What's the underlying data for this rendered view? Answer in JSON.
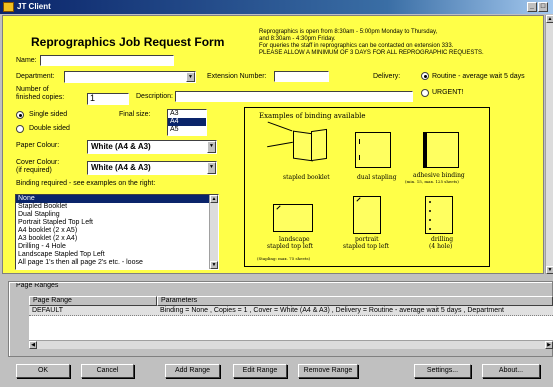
{
  "window": {
    "title": "JT Client",
    "min": "_",
    "max": "□"
  },
  "form": {
    "heading": "Reprographics Job Request Form",
    "info": [
      "Reprographics is open from 8:30am - 5:00pm Monday to Thursday,",
      "and 8:30am - 4:30pm Friday.",
      "For queries the staff in reprographics can be contacted on extension 333.",
      "PLEASE ALLOW A MINIMUM OF 3 DAYS FOR ALL REPROGRAPHIC REQUESTS."
    ],
    "name_label": "Name:",
    "name_value": "",
    "department_label": "Department:",
    "extension_label": "Extension Number:",
    "delivery_label": "Delivery:",
    "delivery_routine": "Routine - average wait 5 days",
    "delivery_urgent": "URGENT!",
    "copies_label_1": "Number of",
    "copies_label_2": "finished copies:",
    "copies_value": "1",
    "description_label": "Description:",
    "single_sided": "Single sided",
    "double_sided": "Double sided",
    "final_size_label": "Final size:",
    "sizes": [
      "A3",
      "A4",
      "A5"
    ],
    "selected_size": "A4",
    "paper_colour_label": "Paper Colour:",
    "paper_colour_value": "White (A4 & A3)",
    "cover_colour_label_1": "Cover Colour:",
    "cover_colour_label_2": "(if required)",
    "cover_colour_value": "White (A4 & A3)",
    "binding_required_label": "Binding required - see examples on the right:",
    "binding_options": [
      "None",
      "Stapled Booklet",
      "Dual Stapling",
      "Portrait Stapled Top Left",
      "A4 booklet (2 x A5)",
      "A3 booklet (2 x A4)",
      "Drilling - 4 Hole",
      "Landscape Stapled Top Left",
      "All page 1's then all page 2's etc. - loose"
    ],
    "binding_selected": "None",
    "binding_panel": {
      "title": "Examples of binding available",
      "labels": {
        "stapled_booklet": "stapled booklet",
        "dual_stapling": "dual stapling",
        "adhesive_1": "adhesive binding",
        "adhesive_2": "(min. 15, max. 125 sheets)",
        "landscape_1": "landscape",
        "landscape_2": "stapled top left",
        "portrait_1": "portrait",
        "portrait_2": "stapled top left",
        "drilling_1": "drilling",
        "drilling_2": "(4 hole)",
        "stapling_note": "(Stapling: max. 75 sheets)"
      }
    }
  },
  "ranges": {
    "title": "Page Ranges",
    "col_range": "Page Range",
    "col_params": "Parameters",
    "rows": [
      {
        "range": "DEFAULT",
        "params": "Binding = None , Copies = 1 , Cover = White (A4 & A3) , Delivery = Routine - average wait 5 days , Department"
      }
    ]
  },
  "buttons": {
    "ok": "OK",
    "cancel": "Cancel",
    "add_range": "Add Range",
    "edit_range": "Edit Range",
    "remove_range": "Remove Range",
    "settings": "Settings...",
    "about": "About..."
  }
}
